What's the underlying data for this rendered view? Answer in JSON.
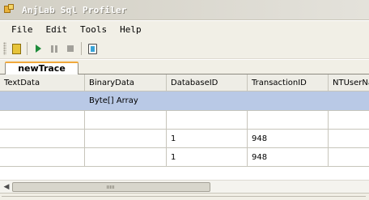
{
  "window": {
    "title": "AnjLab Sql Profiler",
    "icon": "app-icon"
  },
  "menu": {
    "items": [
      "File",
      "Edit",
      "Tools",
      "Help"
    ]
  },
  "toolbar": {
    "buttons": [
      {
        "icon": "new-trace-icon"
      },
      {
        "icon": "play-icon"
      },
      {
        "icon": "pause-icon"
      },
      {
        "icon": "stop-icon"
      },
      {
        "icon": "clear-trace-icon"
      }
    ]
  },
  "tabs": [
    {
      "label": "newTrace",
      "active": true
    }
  ],
  "grid": {
    "columns": [
      "TextData",
      "BinaryData",
      "DatabaseID",
      "TransactionID",
      "NTUserName"
    ],
    "rows": [
      {
        "selected": true,
        "cells": [
          "",
          "Byte[] Array",
          "",
          "",
          ""
        ]
      },
      {
        "selected": false,
        "cells": [
          "",
          "",
          "",
          "",
          ""
        ]
      },
      {
        "selected": false,
        "cells": [
          "",
          "",
          "1",
          "948",
          ""
        ]
      },
      {
        "selected": false,
        "cells": [
          "",
          "",
          "1",
          "948",
          ""
        ]
      }
    ],
    "selected_row_color": "#b9c9e6"
  },
  "scrollbar": {
    "left_arrow": "◀"
  }
}
